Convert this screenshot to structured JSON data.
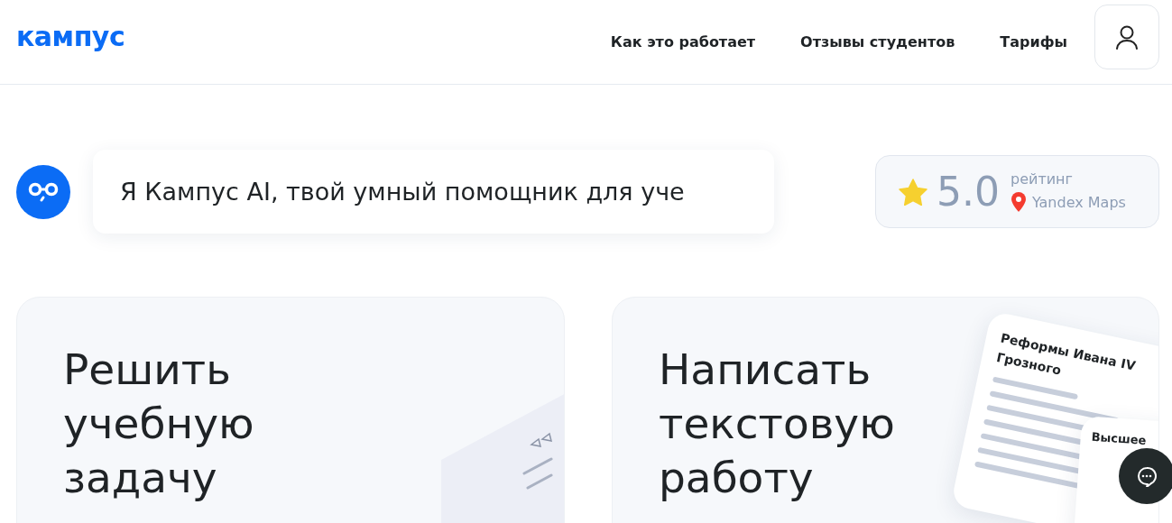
{
  "header": {
    "logo": "кампус",
    "nav": [
      {
        "label": "Как это работает"
      },
      {
        "label": "Отзывы студентов"
      },
      {
        "label": "Тарифы"
      }
    ]
  },
  "assistant": {
    "message": "Я Кампус AI, твой умный помощник для уче"
  },
  "rating": {
    "value": "5.0",
    "label": "рейтинг",
    "source": "Yandex Maps"
  },
  "cards": [
    {
      "title": "Решить учебную задачу",
      "kind": "task"
    },
    {
      "title": "Написать текстовую работу",
      "kind": "text",
      "doc_titles": [
        "Реформы Ивана IV Грозного",
        "Высшее"
      ]
    }
  ]
}
